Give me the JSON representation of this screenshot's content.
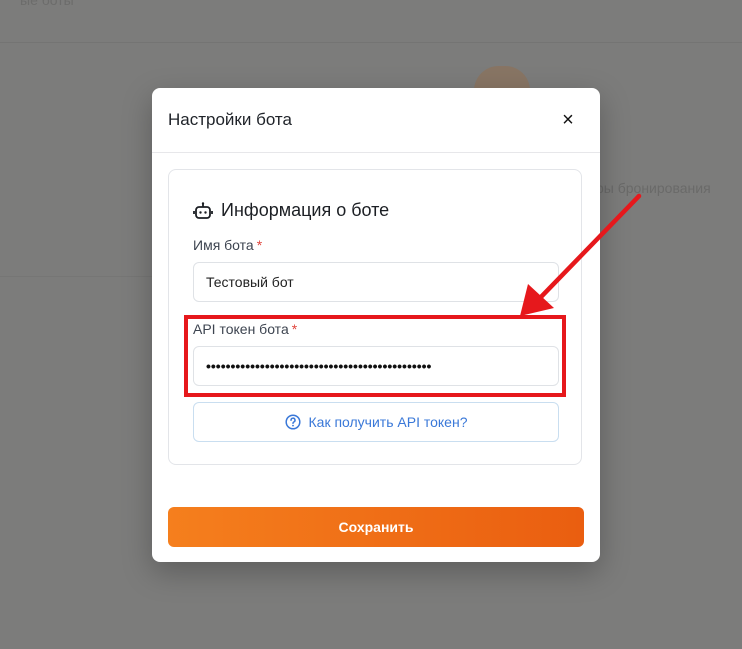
{
  "background": {
    "top_text": "ые боты",
    "right_text": "ры бронирования"
  },
  "modal": {
    "title": "Настройки бота",
    "close_label": "×",
    "section_title": "Информация о боте",
    "fields": {
      "name": {
        "label": "Имя бота",
        "required_mark": "*",
        "value": "Тестовый бот"
      },
      "token": {
        "label": "API токен бота",
        "required_mark": "*",
        "value_masked": "••••••••••••••••••••••••••••••••••••••••••••••"
      }
    },
    "help_button_label": "Как получить API токен?",
    "save_button_label": "Сохранить"
  },
  "colors": {
    "accent_start": "#f57f1d",
    "accent_end": "#ea5e10",
    "link_blue": "#3a78d8",
    "annotation_red": "#e6181c",
    "overlay": "#7c7c7b"
  },
  "icons": {
    "section": "robot-icon",
    "help": "question-circle-icon",
    "close": "close-icon"
  }
}
